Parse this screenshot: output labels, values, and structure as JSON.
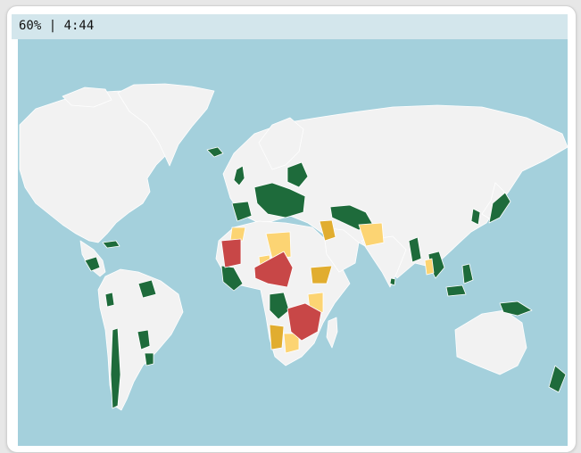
{
  "game": {
    "status_text": "60% | 4:44"
  },
  "map": {
    "ocean_color": "#a4d0dc",
    "colors": {
      "unanswered": "#f2f2f2",
      "correct": "#1e6b3b",
      "partial_light": "#fcd473",
      "partial_dark": "#e1ad2f",
      "wrong": "#c84747"
    }
  }
}
